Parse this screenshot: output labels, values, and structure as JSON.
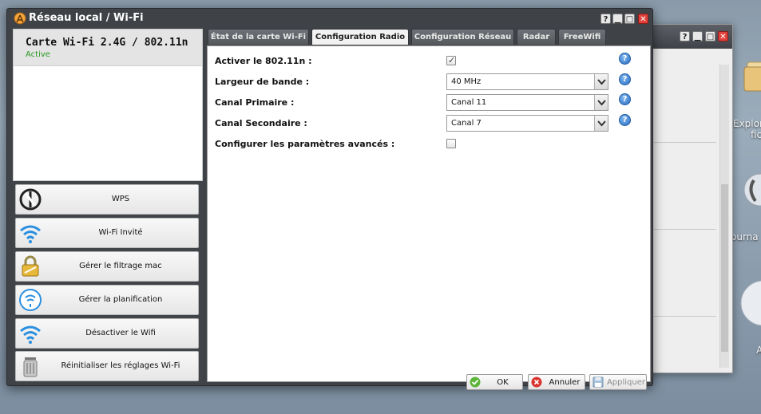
{
  "window": {
    "title": "Réseau local / Wi-Fi",
    "controls": {
      "help": "?",
      "minimize": "▁",
      "maximize": "□",
      "close": "✕"
    }
  },
  "device": {
    "name": "Carte Wi-Fi 2.4G / 802.11n",
    "status": "Active"
  },
  "actions": [
    {
      "label": "WPS",
      "icon": "wps-icon"
    },
    {
      "label": "Wi-Fi Invité",
      "icon": "wifi-icon"
    },
    {
      "label": "Gérer le filtrage mac",
      "icon": "lock-icon"
    },
    {
      "label": "Gérer la planification",
      "icon": "schedule-icon"
    },
    {
      "label": "Désactiver le Wifi",
      "icon": "wifi-icon"
    },
    {
      "label": "Réinitialiser les réglages Wi-Fi",
      "icon": "trash-icon"
    }
  ],
  "tabs": [
    {
      "label": "État de la carte Wi-Fi",
      "active": false
    },
    {
      "label": "Configuration Radio",
      "active": true
    },
    {
      "label": "Configuration Réseau",
      "active": false
    },
    {
      "label": "Radar",
      "active": false
    },
    {
      "label": "FreeWifi",
      "active": false
    }
  ],
  "form": {
    "enable_80211n": {
      "label": "Activer le 802.11n :",
      "checked": true
    },
    "bandwidth": {
      "label": "Largeur de bande :",
      "value": "40 MHz"
    },
    "primary_channel": {
      "label": "Canal Primaire :",
      "value": "Canal 11"
    },
    "secondary_channel": {
      "label": "Canal Secondaire :",
      "value": "Canal 7"
    },
    "advanced": {
      "label": "Configurer les paramètres avancés :",
      "checked": false
    }
  },
  "footer": {
    "ok": "OK",
    "cancel": "Annuler",
    "apply": "Appliquer"
  },
  "desktop": {
    "labels": [
      "Explor",
      "fic",
      "ourna",
      "A"
    ]
  },
  "colors": {
    "titlebar": "#3f4247",
    "status_active": "#2a9a20",
    "help_blue": "#2a6fc2",
    "close_red": "#e0413b"
  }
}
